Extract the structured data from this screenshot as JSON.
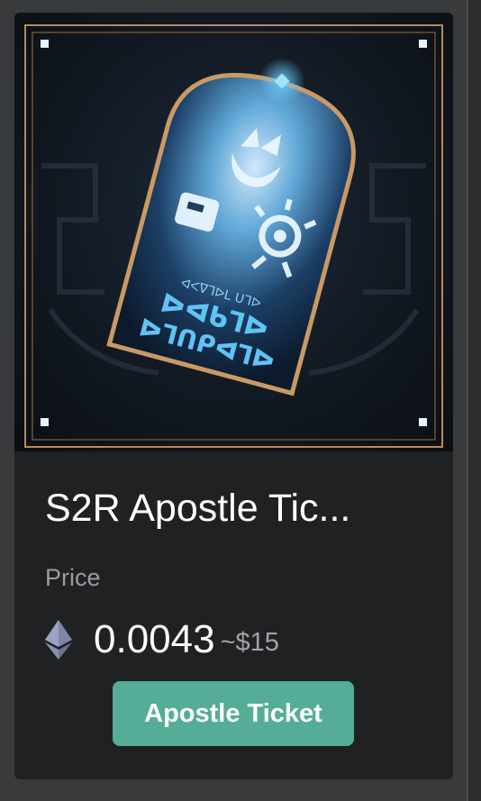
{
  "card": {
    "title": "S2R Apostle Tic...",
    "price_label": "Price",
    "price_value": "0.0043",
    "price_usd": "~$15",
    "currency_icon": "ethereum-icon",
    "button_label": "Apostle Ticket",
    "image": {
      "rune_line_small": "ᐊᐸᐁᒣᐅᒪ ᑌᒣᐅ",
      "rune_line_1": "ᐅᐊᑲᒣᐅ",
      "rune_line_2": "ᐅᒣᑎᑭᐊᒣᐅ"
    }
  },
  "colors": {
    "accent": "#55ad97",
    "card_bg": "#202122",
    "frame_gold": "#b68a5a",
    "glow_blue": "#5fc3f5"
  }
}
